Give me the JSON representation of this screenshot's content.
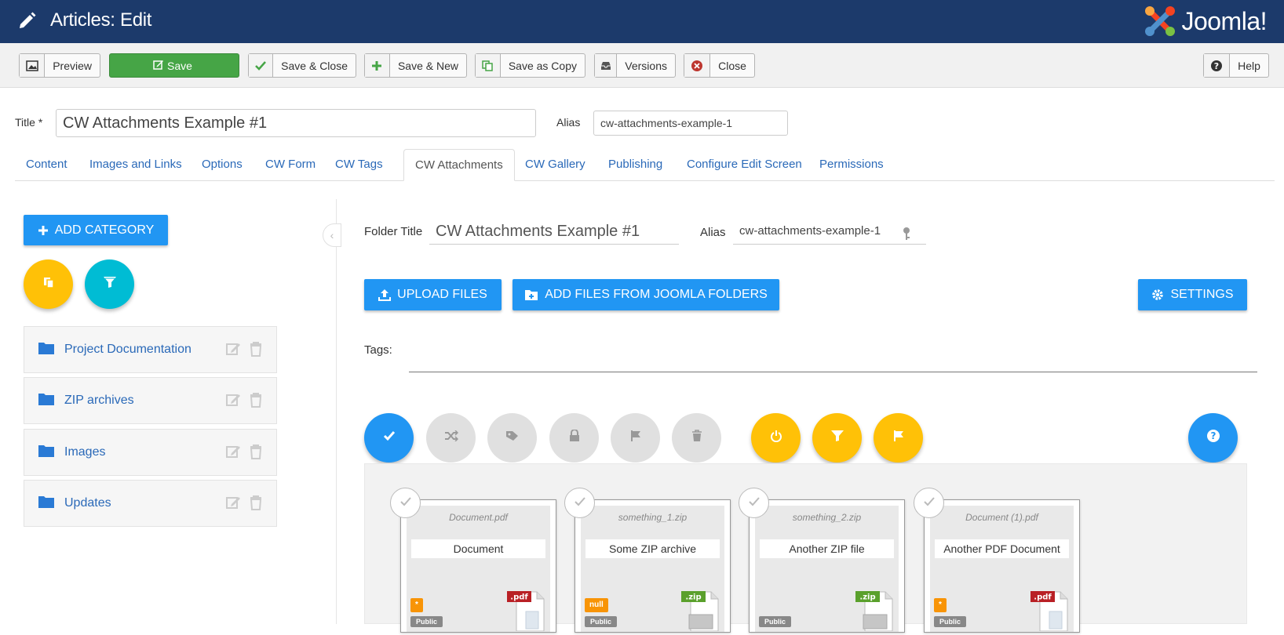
{
  "header": {
    "title": "Articles: Edit",
    "brand": "Joomla!",
    "icons": [
      "pencil-icon",
      "joomla-logo"
    ]
  },
  "toolbar": {
    "preview": "Preview",
    "save": "Save",
    "save_close": "Save & Close",
    "save_new": "Save & New",
    "save_copy": "Save as Copy",
    "versions": "Versions",
    "close": "Close",
    "help": "Help"
  },
  "form": {
    "title_label": "Title *",
    "title_value": "CW Attachments Example #1",
    "alias_label": "Alias",
    "alias_value": "cw-attachments-example-1"
  },
  "tabs": [
    {
      "label": "Content"
    },
    {
      "label": "Images and Links"
    },
    {
      "label": "Options"
    },
    {
      "label": "CW Form"
    },
    {
      "label": "CW Tags"
    },
    {
      "label": "CW Attachments",
      "active": true
    },
    {
      "label": "CW Gallery"
    },
    {
      "label": "Publishing"
    },
    {
      "label": "Configure Edit Screen"
    },
    {
      "label": "Permissions"
    }
  ],
  "sidebar": {
    "add_category": "ADD CATEGORY",
    "categories": [
      {
        "name": "Project Documentation"
      },
      {
        "name": "ZIP archives"
      },
      {
        "name": "Images"
      },
      {
        "name": "Updates"
      }
    ]
  },
  "main": {
    "folder_title_label": "Folder Title",
    "folder_title_value": "CW Attachments Example #1",
    "folder_alias_label": "Alias",
    "folder_alias_value": "cw-attachments-example-1",
    "upload": "UPLOAD FILES",
    "add_joomla": "ADD FILES FROM JOOMLA FOLDERS",
    "settings": "SETTINGS",
    "tags_label": "Tags:",
    "colors": {
      "primary": "#2196f3",
      "accent": "#ffc107",
      "header": "#1c3a6b",
      "save": "#46a546"
    }
  },
  "files": [
    {
      "filename": "Document.pdf",
      "caption": "Document",
      "badge": "*",
      "ext": ".pdf",
      "status": "Public"
    },
    {
      "filename": "something_1.zip",
      "caption": "Some ZIP archive",
      "badge": "null",
      "ext": ".zip",
      "status": "Public"
    },
    {
      "filename": "something_2.zip",
      "caption": "Another ZIP file",
      "badge": "",
      "ext": ".zip",
      "status": "Public"
    },
    {
      "filename": "Document (1).pdf",
      "caption": "Another PDF Document",
      "badge": "*",
      "ext": ".pdf",
      "status": "Public"
    }
  ]
}
